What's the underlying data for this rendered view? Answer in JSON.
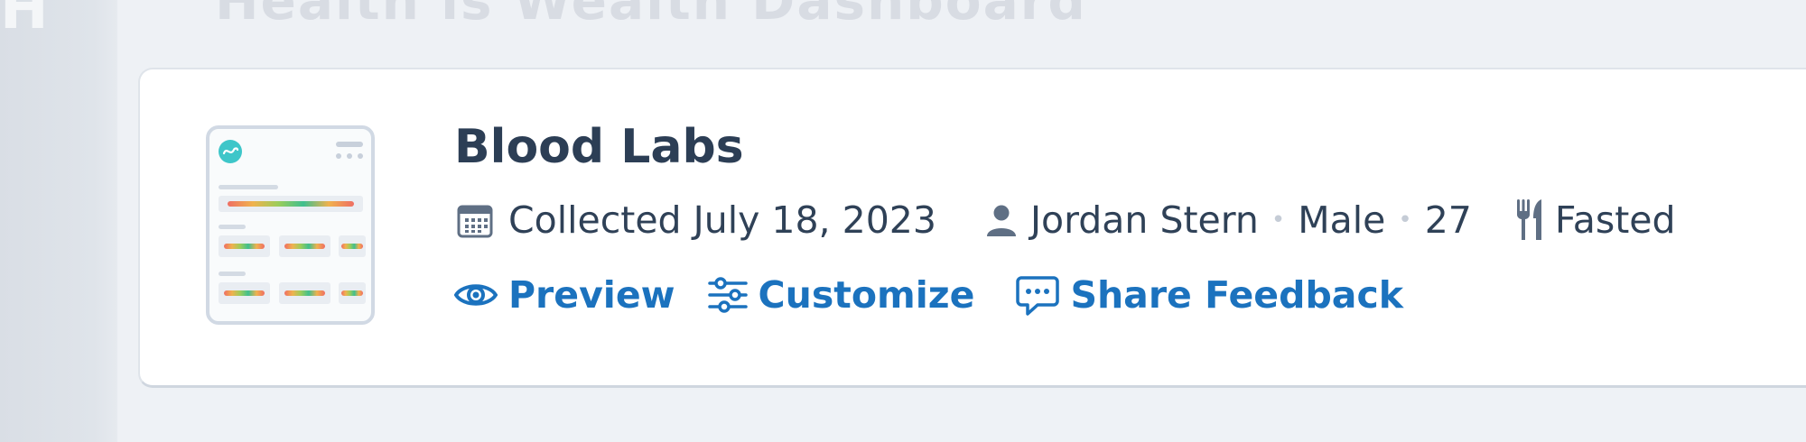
{
  "sidebar": {
    "glyph": "H"
  },
  "page": {
    "heading": "Health is Wealth Dashboard"
  },
  "report": {
    "title": "Blood Labs",
    "collected": "Collected July 18, 2023",
    "patient_name": "Jordan Stern",
    "sex": "Male",
    "age": "27",
    "fasting_status": "Fasted",
    "separator": "•"
  },
  "actions": {
    "preview": "Preview",
    "customize": "Customize",
    "share_feedback": "Share Feedback"
  },
  "icons": {
    "calendar": "calendar-icon",
    "person": "person-icon",
    "fork_knife": "fork-knife-icon",
    "eye": "eye-icon",
    "sliders": "sliders-icon",
    "chat": "chat-bubble-icon"
  },
  "colors": {
    "action_blue": "#1b72be",
    "text_dark": "#2f4157",
    "title": "#2c3e55",
    "icon_gray": "#5f6f84",
    "logo_teal": "#3ec6c9"
  }
}
